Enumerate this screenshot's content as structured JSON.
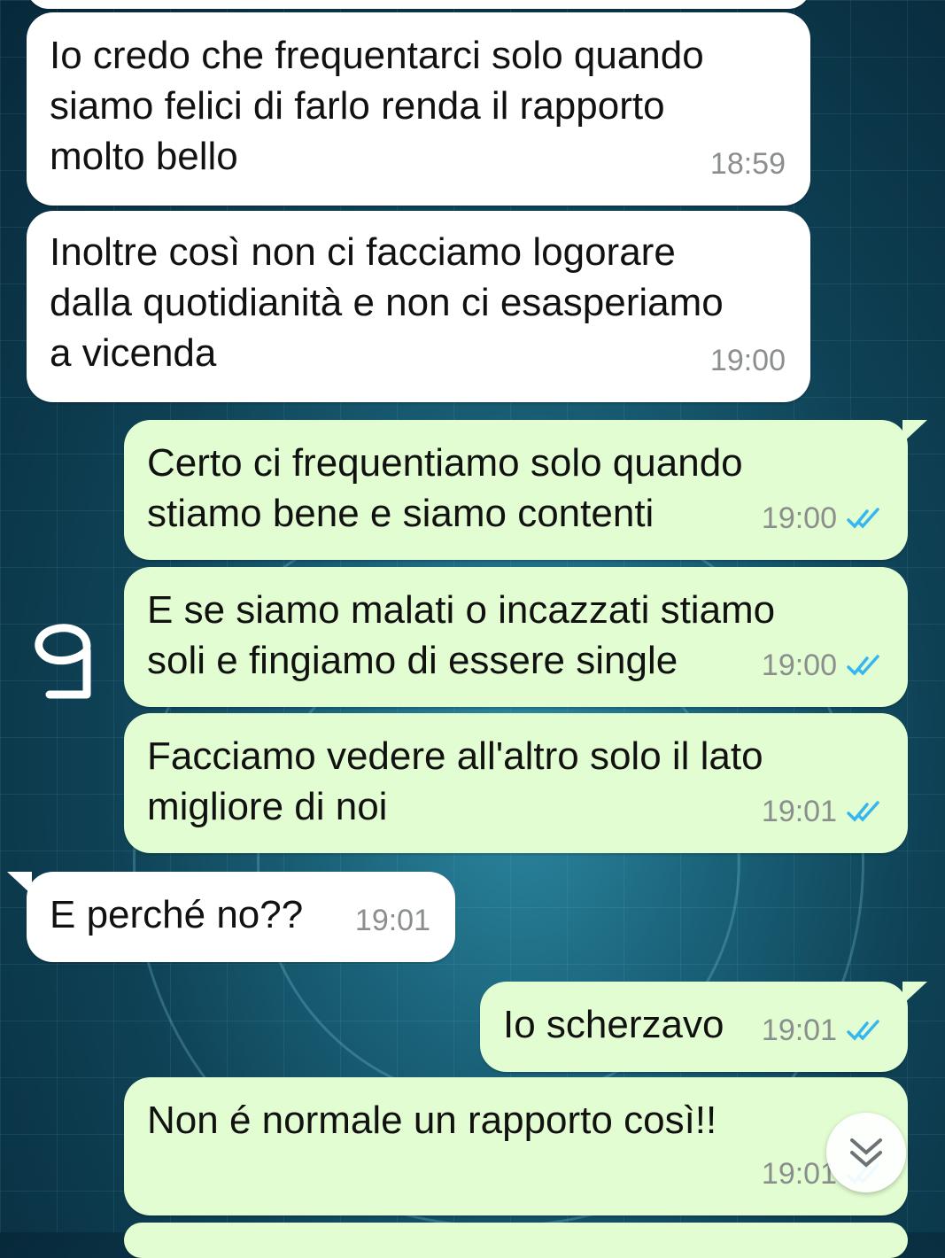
{
  "messages": [
    {
      "dir": "in",
      "text": "Io credo che frequentarci solo quando\nsiamo felici di farlo renda il rapporto\nmolto bello",
      "time": "18:59"
    },
    {
      "dir": "in",
      "text": "Inoltre così non ci facciamo logorare\ndalla quotidianità e non ci esasperiamo\na vicenda",
      "time": "19:00"
    },
    {
      "dir": "out",
      "text": "Certo ci frequentiamo solo quando\nstiamo bene e siamo contenti",
      "time": "19:00",
      "status": "read"
    },
    {
      "dir": "out",
      "text": "E se siamo malati o incazzati stiamo\nsoli e fingiamo di essere single",
      "time": "19:00",
      "status": "read"
    },
    {
      "dir": "out",
      "text": "Facciamo vedere all'altro solo il lato\nmigliore di noi",
      "time": "19:01",
      "status": "read"
    },
    {
      "dir": "in",
      "text": "E perché no??",
      "time": "19:01"
    },
    {
      "dir": "out",
      "text": "Io scherzavo",
      "time": "19:01",
      "status": "read"
    },
    {
      "dir": "out",
      "text": "Non é normale un rapporto così!!",
      "time": "19:01",
      "status": "read"
    }
  ],
  "colors": {
    "incoming_bubble": "#ffffff",
    "outgoing_bubble": "#e2fdd1",
    "read_ticks": "#34b7f1",
    "timestamp": "#8a8f8e"
  },
  "icons": {
    "read_receipt": "double-check-icon",
    "scroll_down": "chevron-double-down-icon",
    "annotation": "handwritten-glyph"
  }
}
